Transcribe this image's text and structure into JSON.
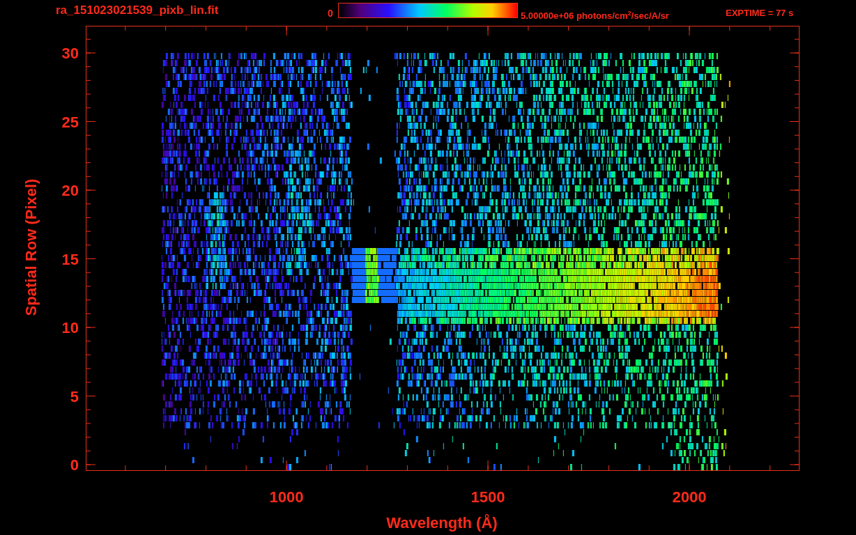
{
  "header": {
    "title": "ra_151023021539_pixb_lin.fit",
    "colorbar": {
      "min_label": "0",
      "max_label": "5.00000e+06 photons/cm$^{2}$/sec/A/sr"
    },
    "exposure": "EXPTIME = 77 s"
  },
  "plot": {
    "xlabel": "Wavelength (Å)",
    "ylabel": "Spatial Row (Pixel)",
    "xticks": [
      "1000",
      "1500",
      "2000"
    ],
    "yticks": [
      "30",
      "25",
      "20",
      "15",
      "10",
      "5",
      "0"
    ]
  }
}
